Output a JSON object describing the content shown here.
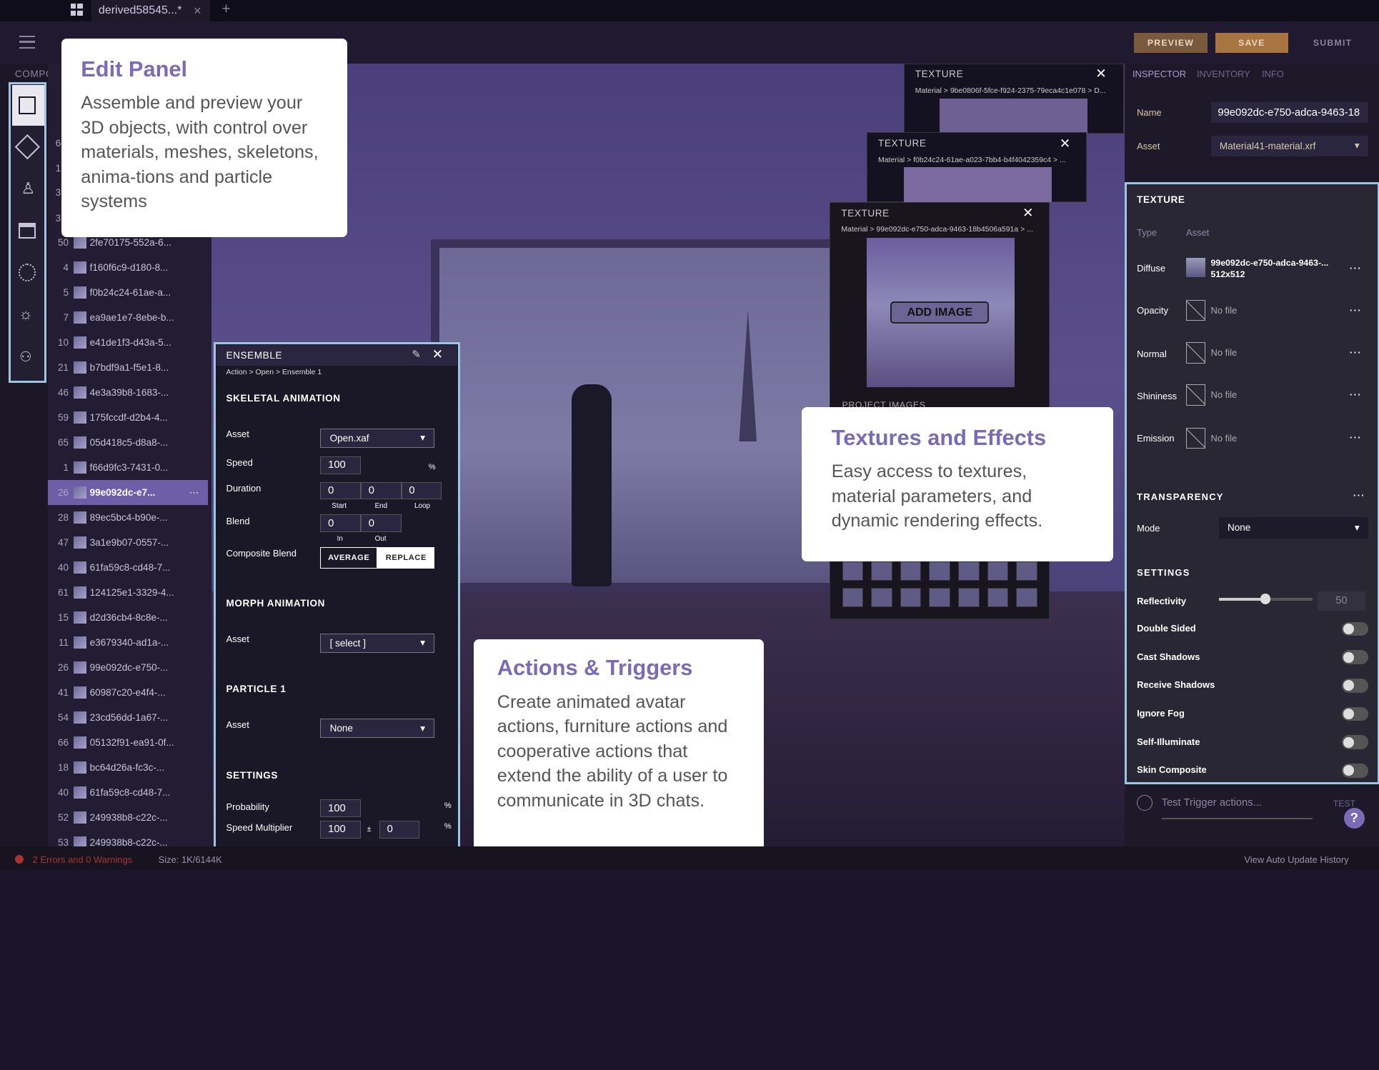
{
  "tab": {
    "title": "derived58545...*",
    "close": "×",
    "add": "+"
  },
  "toolbar": {
    "preview": "PREVIEW",
    "save": "SAVE",
    "submit": "SUBMIT"
  },
  "left": {
    "components_label": "COMPONE"
  },
  "components": [
    {
      "n": "50",
      "label": "2fe70175-552a-6..."
    },
    {
      "n": "4",
      "label": "f160f6c9-d180-8..."
    },
    {
      "n": "5",
      "label": "f0b24c24-61ae-a..."
    },
    {
      "n": "7",
      "label": "ea9ae1e7-8ebe-b..."
    },
    {
      "n": "10",
      "label": "e41de1f3-d43a-5..."
    },
    {
      "n": "21",
      "label": "b7bdf9a1-f5e1-8..."
    },
    {
      "n": "46",
      "label": "4e3a39b8-1683-..."
    },
    {
      "n": "59",
      "label": "175fccdf-d2b4-4..."
    },
    {
      "n": "65",
      "label": "05d418c5-d8a8-..."
    },
    {
      "n": "1",
      "label": "f66d9fc3-7431-0..."
    },
    {
      "n": "26",
      "label": "99e092dc-e7..."
    },
    {
      "n": "28",
      "label": "89ec5bc4-b90e-..."
    },
    {
      "n": "47",
      "label": "3a1e9b07-0557-..."
    },
    {
      "n": "40",
      "label": "61fa59c8-cd48-7..."
    },
    {
      "n": "61",
      "label": "124125e1-3329-4..."
    },
    {
      "n": "15",
      "label": "d2d36cb4-8c8e-..."
    },
    {
      "n": "11",
      "label": "e3679340-ad1a-..."
    },
    {
      "n": "26",
      "label": "99e092dc-e750-..."
    },
    {
      "n": "41",
      "label": "60987c20-e4f4-..."
    },
    {
      "n": "54",
      "label": "23cd56dd-1a67-..."
    },
    {
      "n": "66",
      "label": "05132f91-ea91-0f..."
    },
    {
      "n": "18",
      "label": "bc64d26a-fc3c-..."
    },
    {
      "n": "40",
      "label": "61fa59c8-cd48-7..."
    },
    {
      "n": "52",
      "label": "249938b8-c22c-..."
    },
    {
      "n": "53",
      "label": "249938b8-c22c-..."
    }
  ],
  "partial_rows": [
    "6",
    "12",
    "3",
    "3"
  ],
  "edit_callout": {
    "title": "Edit Panel",
    "body": "Assemble and preview your 3D objects, with control over materials, meshes, skeletons, anima-tions and particle systems"
  },
  "ensemble": {
    "title": "ENSEMBLE",
    "breadcrumb": "Action > Open > Ensemble 1",
    "skeletal": "SKELETAL ANIMATION",
    "asset_label": "Asset",
    "asset_value": "Open.xaf",
    "speed_label": "Speed",
    "speed_value": "100",
    "percent": "%",
    "duration_label": "Duration",
    "start": "0",
    "end": "0",
    "loop": "0",
    "start_l": "Start",
    "end_l": "End",
    "loop_l": "Loop",
    "blend_label": "Blend",
    "in": "0",
    "out": "0",
    "in_l": "In",
    "out_l": "Out",
    "composite_label": "Composite Blend",
    "average": "AVERAGE",
    "replace": "REPLACE",
    "morph": "MORPH ANIMATION",
    "morph_asset": "Asset",
    "morph_value": "[ select ]",
    "particle": "PARTICLE 1",
    "particle_asset": "Asset",
    "particle_value": "None",
    "settings": "SETTINGS",
    "prob_label": "Probability",
    "prob_value": "100",
    "speedmult_label": "Speed Multiplier",
    "speedmult_value": "100",
    "pm": "±",
    "speedmult_var": "0"
  },
  "actions_callout": {
    "title": "Actions & Triggers",
    "body": "Create animated avatar actions, furniture actions and cooperative actions that extend the ability of a user to communicate in 3D chats."
  },
  "textures": [
    {
      "title": "TEXTURE",
      "path": "Material > 9be0806f-5fce-f924-2375-79eca4c1e078 > D..."
    },
    {
      "title": "TEXTURE",
      "path": "Material > f0b24c24-61ae-a023-7bb4-b4f4042359c4 > ..."
    },
    {
      "title": "TEXTURE",
      "path": "Material > 99e092dc-e750-adca-9463-18b4506a591a > ..."
    }
  ],
  "add_image": "ADD IMAGE",
  "project_images": "PROJECT IMAGES",
  "tex_callout": {
    "title": "Textures and Effects",
    "body": "Easy access to textures, material parameters, and dynamic rendering effects."
  },
  "inspector": {
    "tabs": [
      "INSPECTOR",
      "INVENTORY",
      "INFO"
    ],
    "name_label": "Name",
    "name_value": "99e092dc-e750-adca-9463-18",
    "asset_label": "Asset",
    "asset_value": "Material41-material.xrf",
    "texture": "TEXTURE",
    "type_label": "Type",
    "type_value": "Asset",
    "diffuse": "Diffuse",
    "diffuse_file": "99e092dc-e750-adca-9463-...",
    "diffuse_size": "512x512",
    "opacity": "Opacity",
    "normal": "Normal",
    "shininess": "Shininess",
    "emission": "Emission",
    "nofile": "No file",
    "transparency": "TRANSPARENCY",
    "mode_label": "Mode",
    "mode_value": "None",
    "settings": "SETTINGS",
    "reflectivity": "Reflectivity",
    "reflect_value": "50",
    "toggles": [
      "Double Sided",
      "Cast Shadows",
      "Receive Shadows",
      "Ignore Fog",
      "Self-Illuminate",
      "Skin Composite"
    ],
    "trigger_placeholder": "Test Trigger actions...",
    "test": "TEST",
    "help": "?"
  },
  "status": {
    "errors": "2 Errors and 0 Warnings",
    "size": "Size: 1K/6144K",
    "history": "View Auto Update History"
  }
}
